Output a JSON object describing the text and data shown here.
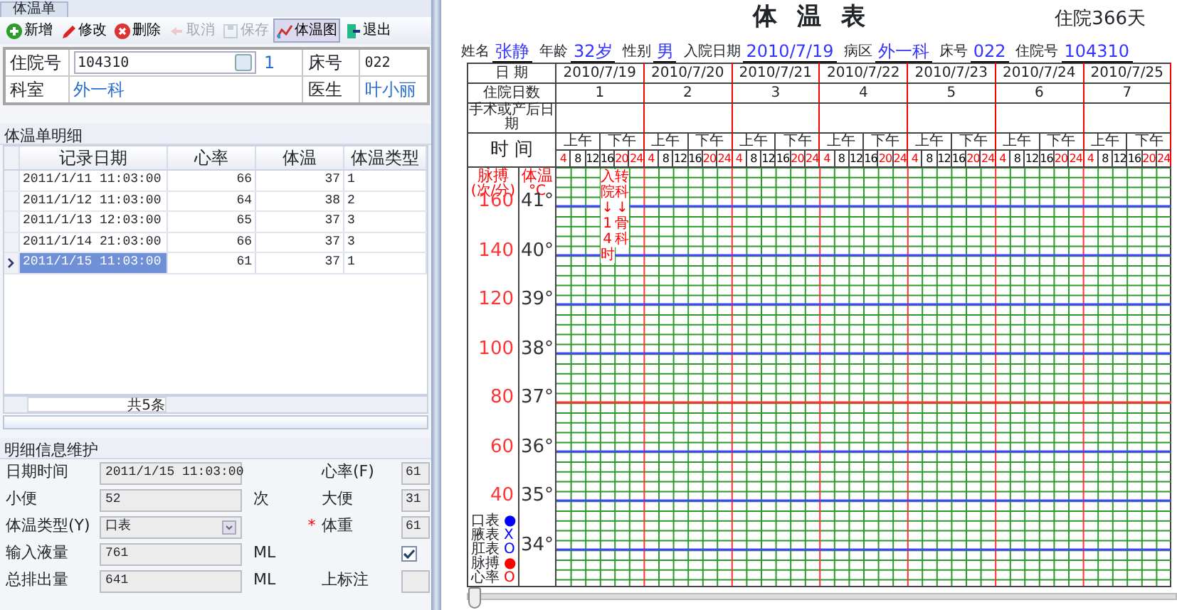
{
  "left": {
    "tab": "体温单",
    "toolbar": [
      {
        "label": "新增",
        "disabled": false,
        "selected": false
      },
      {
        "label": "修改",
        "disabled": false,
        "selected": false
      },
      {
        "label": "删除",
        "disabled": false,
        "selected": false
      },
      {
        "label": "取消",
        "disabled": true,
        "selected": false
      },
      {
        "label": "保存",
        "disabled": true,
        "selected": false
      },
      {
        "label": "体温图",
        "disabled": false,
        "selected": true
      },
      {
        "label": "退出",
        "disabled": false,
        "selected": false
      }
    ],
    "info": [
      [
        {
          "label": "住院号",
          "value": "104310",
          "kind": "combo",
          "extra": "1"
        },
        {
          "label": "床号",
          "value": "022",
          "kind": "text"
        }
      ],
      [
        {
          "label": "科室",
          "value": "外一科",
          "kind": "link"
        },
        {
          "label": "医生",
          "value": "叶小丽",
          "kind": "link"
        }
      ]
    ],
    "grid": {
      "title": "体温单明细",
      "columns": [
        "记录日期",
        "心率",
        "体温",
        "体温类型"
      ],
      "rows": [
        {
          "cells": [
            "2011/1/11 11:03:00",
            "66",
            "37",
            "1"
          ],
          "selected": false
        },
        {
          "cells": [
            "2011/1/12 11:03:00",
            "64",
            "38",
            "2"
          ],
          "selected": false
        },
        {
          "cells": [
            "2011/1/13 12:03:00",
            "65",
            "37",
            "3"
          ],
          "selected": false
        },
        {
          "cells": [
            "2011/1/14 21:03:00",
            "66",
            "37",
            "3"
          ],
          "selected": false
        },
        {
          "cells": [
            "2011/1/15 11:03:00",
            "61",
            "37",
            "1"
          ],
          "selected": true
        }
      ],
      "footer": "共5条"
    },
    "form": {
      "title": "明细信息维护",
      "rows": [
        {
          "label": "日期时间",
          "value": "2011/1/15 11:03:00",
          "kind": "text",
          "right": {
            "label": "心率(F)",
            "value": "61",
            "kind": "text"
          }
        },
        {
          "label": "小便",
          "value": "52",
          "kind": "text",
          "unit": "次",
          "right": {
            "label": "大便",
            "value": "31",
            "kind": "text"
          }
        },
        {
          "label": "体温类型(Y)",
          "value": "口表",
          "kind": "combo",
          "right": {
            "label": "体重",
            "value": "61",
            "kind": "text",
            "required_mark": "*"
          }
        },
        {
          "label": "输入液量",
          "value": "761",
          "kind": "text",
          "unit": "ML",
          "right": {
            "kind": "checkbox",
            "checked": true
          }
        },
        {
          "label": "总排出量",
          "value": "641",
          "kind": "text",
          "unit": "ML",
          "right": {
            "label": "上标注",
            "kind": "text"
          }
        }
      ]
    }
  },
  "chart": {
    "title": "体温表",
    "stay": "住院366天",
    "patient": [
      {
        "label": "姓名",
        "value": "张静"
      },
      {
        "label": "年龄",
        "value": "32岁"
      },
      {
        "label": "性别",
        "value": "男"
      },
      {
        "label": "入院日期",
        "value": "2010/7/19"
      },
      {
        "label": "病区",
        "value": "外一科"
      },
      {
        "label": "床号",
        "value": "022"
      },
      {
        "label": "住院号",
        "value": "104310"
      }
    ],
    "row_labels": {
      "date": "日 期",
      "days": "住院日数",
      "surgery": "手术或产后日期",
      "time": "时 间"
    },
    "days": [
      {
        "date": "2010/7/19",
        "number": "1",
        "am": "上午",
        "pm": "下午",
        "hours": [
          {
            "text": "4",
            "color": "#ff0000"
          },
          {
            "text": "8",
            "color": "#000000"
          },
          {
            "text": "12",
            "color": "#000000"
          },
          {
            "text": "16",
            "color": "#000000"
          },
          {
            "text": "20",
            "color": "#ff0000"
          },
          {
            "text": "24",
            "color": "#ff0000"
          }
        ]
      },
      {
        "date": "2010/7/20",
        "number": "2",
        "am": "上午",
        "pm": "下午",
        "hours": [
          {
            "text": "4",
            "color": "#ff0000"
          },
          {
            "text": "8",
            "color": "#000000"
          },
          {
            "text": "12",
            "color": "#000000"
          },
          {
            "text": "16",
            "color": "#000000"
          },
          {
            "text": "20",
            "color": "#ff0000"
          },
          {
            "text": "24",
            "color": "#ff0000"
          }
        ]
      },
      {
        "date": "2010/7/21",
        "number": "3",
        "am": "上午",
        "pm": "下午",
        "hours": [
          {
            "text": "4",
            "color": "#ff0000"
          },
          {
            "text": "8",
            "color": "#000000"
          },
          {
            "text": "12",
            "color": "#000000"
          },
          {
            "text": "16",
            "color": "#000000"
          },
          {
            "text": "20",
            "color": "#ff0000"
          },
          {
            "text": "24",
            "color": "#ff0000"
          }
        ]
      },
      {
        "date": "2010/7/22",
        "number": "4",
        "am": "上午",
        "pm": "下午",
        "hours": [
          {
            "text": "4",
            "color": "#ff0000"
          },
          {
            "text": "8",
            "color": "#000000"
          },
          {
            "text": "12",
            "color": "#000000"
          },
          {
            "text": "16",
            "color": "#000000"
          },
          {
            "text": "20",
            "color": "#ff0000"
          },
          {
            "text": "24",
            "color": "#ff0000"
          }
        ]
      },
      {
        "date": "2010/7/23",
        "number": "5",
        "am": "上午",
        "pm": "下午",
        "hours": [
          {
            "text": "4",
            "color": "#ff0000"
          },
          {
            "text": "8",
            "color": "#000000"
          },
          {
            "text": "12",
            "color": "#000000"
          },
          {
            "text": "16",
            "color": "#000000"
          },
          {
            "text": "20",
            "color": "#ff0000"
          },
          {
            "text": "24",
            "color": "#ff0000"
          }
        ]
      },
      {
        "date": "2010/7/24",
        "number": "6",
        "am": "上午",
        "pm": "下午",
        "hours": [
          {
            "text": "4",
            "color": "#ff0000"
          },
          {
            "text": "8",
            "color": "#000000"
          },
          {
            "text": "12",
            "color": "#000000"
          },
          {
            "text": "16",
            "color": "#000000"
          },
          {
            "text": "20",
            "color": "#ff0000"
          },
          {
            "text": "24",
            "color": "#ff0000"
          }
        ]
      },
      {
        "date": "2010/7/25",
        "number": "7",
        "am": "上午",
        "pm": "下午",
        "hours": [
          {
            "text": "4",
            "color": "#ff0000"
          },
          {
            "text": "8",
            "color": "#000000"
          },
          {
            "text": "12",
            "color": "#000000"
          },
          {
            "text": "16",
            "color": "#000000"
          },
          {
            "text": "20",
            "color": "#ff0000"
          },
          {
            "text": "24",
            "color": "#ff0000"
          }
        ]
      }
    ],
    "pulse_header": {
      "title": "脉搏",
      "unit": "(次/分)"
    },
    "temp_header": {
      "title": "体温",
      "unit": "°C"
    },
    "pulse_ticks": [
      "160",
      "140",
      "120",
      "100",
      "80",
      "60",
      "40"
    ],
    "temp_ticks": [
      "41°",
      "40°",
      "39°",
      "38°",
      "37°",
      "36°",
      "35°",
      "34°"
    ],
    "notes": [
      "入院↓14时",
      "转科↓骨科"
    ],
    "legend": [
      {
        "label": "口表",
        "symbol": "●",
        "color": "#0000ff"
      },
      {
        "label": "腋表",
        "symbol": "X",
        "color": "#0000ff"
      },
      {
        "label": "肛表",
        "symbol": "O",
        "color": "#0000ff"
      },
      {
        "label": "脉搏",
        "symbol": "●",
        "color": "#ff0000"
      },
      {
        "label": "心率",
        "symbol": "O",
        "color": "#ff0000"
      }
    ],
    "slider": {
      "level": 0
    }
  }
}
